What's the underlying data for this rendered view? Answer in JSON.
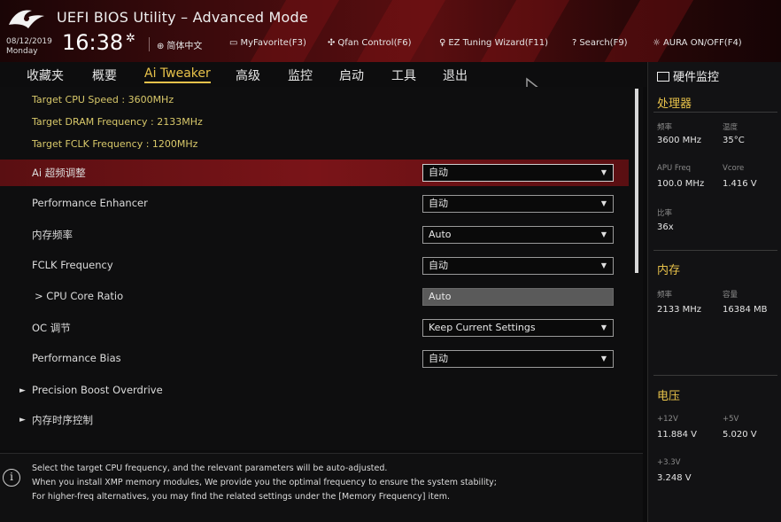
{
  "header": {
    "title": "UEFI BIOS Utility – Advanced Mode",
    "date": "08/12/2019",
    "day": "Monday",
    "time": "16:38",
    "items": [
      {
        "icon": "globe-icon",
        "label": "简体中文"
      },
      {
        "icon": "favorite-icon",
        "label": "MyFavorite(F3)"
      },
      {
        "icon": "fan-icon",
        "label": "Qfan Control(F6)"
      },
      {
        "icon": "wizard-icon",
        "label": "EZ Tuning Wizard(F11)"
      },
      {
        "icon": "search-icon",
        "label": "Search(F9)"
      },
      {
        "icon": "aura-icon",
        "label": "AURA ON/OFF(F4)"
      }
    ]
  },
  "tabs": [
    {
      "label": "收藏夹",
      "active": false
    },
    {
      "label": "概要",
      "active": false
    },
    {
      "label": "Ai Tweaker",
      "active": true
    },
    {
      "label": "高级",
      "active": false
    },
    {
      "label": "监控",
      "active": false
    },
    {
      "label": "启动",
      "active": false
    },
    {
      "label": "工具",
      "active": false
    },
    {
      "label": "退出",
      "active": false
    }
  ],
  "info_lines": [
    "Target CPU Speed : 3600MHz",
    "Target DRAM Frequency : 2133MHz",
    "Target FCLK Frequency : 1200MHz"
  ],
  "settings": [
    {
      "label": "Ai 超频调整",
      "value": "自动",
      "type": "dropdown",
      "highlighted": true
    },
    {
      "label": "Performance Enhancer",
      "value": "自动",
      "type": "dropdown"
    },
    {
      "label": "内存频率",
      "value": "Auto",
      "type": "dropdown"
    },
    {
      "label": "FCLK Frequency",
      "value": "自动",
      "type": "dropdown"
    },
    {
      "label": "> CPU Core Ratio",
      "value": "Auto",
      "type": "disabled"
    },
    {
      "label": "OC 调节",
      "value": "Keep Current Settings",
      "type": "dropdown"
    },
    {
      "label": "Performance Bias",
      "value": "自动",
      "type": "dropdown"
    }
  ],
  "submenus": [
    {
      "label": "Precision Boost Overdrive"
    },
    {
      "label": "内存时序控制"
    }
  ],
  "help": {
    "lines": [
      "Select the target CPU frequency, and the relevant parameters will be auto-adjusted.",
      "When you install XMP memory modules, We provide you the optimal frequency to ensure the system stability;",
      "For higher-freq alternatives, you may find the related settings under the [Memory Frequency] item."
    ]
  },
  "hardware_monitor": {
    "title": "硬件监控",
    "processor": {
      "title": "处理器",
      "freq_label": "频率",
      "freq_value": "3600 MHz",
      "temp_label": "温度",
      "temp_value": "35°C",
      "apu_label": "APU Freq",
      "apu_value": "100.0 MHz",
      "vcore_label": "Vcore",
      "vcore_value": "1.416 V",
      "ratio_label": "比率",
      "ratio_value": "36x"
    },
    "memory": {
      "title": "内存",
      "freq_label": "频率",
      "freq_value": "2133 MHz",
      "cap_label": "容量",
      "cap_value": "16384 MB"
    },
    "voltage": {
      "title": "电压",
      "v12_label": "+12V",
      "v12_value": "11.884 V",
      "v5_label": "+5V",
      "v5_value": "5.020 V",
      "v33_label": "+3.3V",
      "v33_value": "3.248 V"
    }
  },
  "colors": {
    "accent_gold": "#e8c24a",
    "highlight_red": "#7a1418",
    "header_red": "#5a0e10"
  }
}
